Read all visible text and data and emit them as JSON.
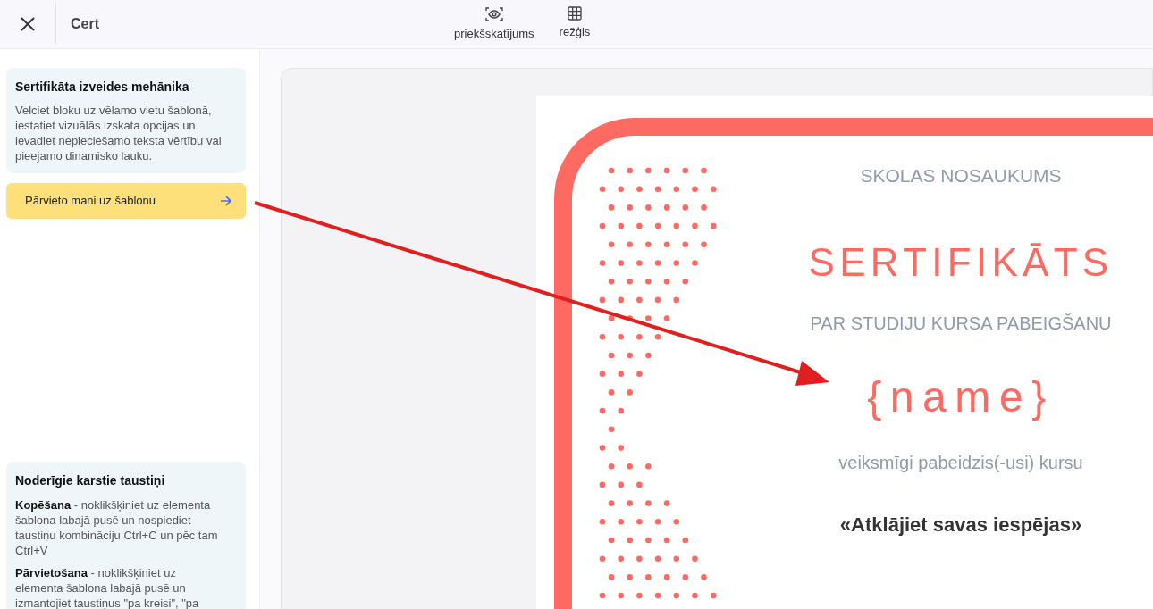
{
  "header": {
    "title": "Cert"
  },
  "tools": [
    {
      "kind": "preview",
      "label": "priekšskatījums"
    },
    {
      "kind": "grid",
      "label": "režģis"
    }
  ],
  "sidebar": {
    "info_card": {
      "title": "Sertifikāta izveides mehānika",
      "text": "Velciet bloku uz vēlamo vietu šablonā, iestatiet vizuālās izskata opcijas un ievadiet nepieciešamo teksta vērtību vai pieejamo dinamisko lauku."
    },
    "drag_block": {
      "label": "Pārvieto mani uz šablonu"
    },
    "hotkeys_card": {
      "title": "Noderīgie karstie taustiņi",
      "items": [
        "**Kopēšana** - noklikšķiniet uz elementa šablona labajā pusē un nospiediet taustiņu kombināciju Ctrl+C un pēc tam Ctrl+V",
        "**Pārvietošana** - noklikšķiniet uz elementa šablona labajā pusē un izmantojiet taustiņus \"pa kreisi\", \"pa"
      ]
    }
  },
  "certificate": {
    "school": "SKOLAS NOSAUKUMS",
    "title": "SERTIFIKĀTS",
    "subtitle": "PAR STUDIJU KURSA PABEIGŠANU",
    "name": "{name}",
    "completed": "veiksmīgi pabeidzis(-usi) kursu",
    "course": "«Atklājiet savas iespējas»"
  }
}
